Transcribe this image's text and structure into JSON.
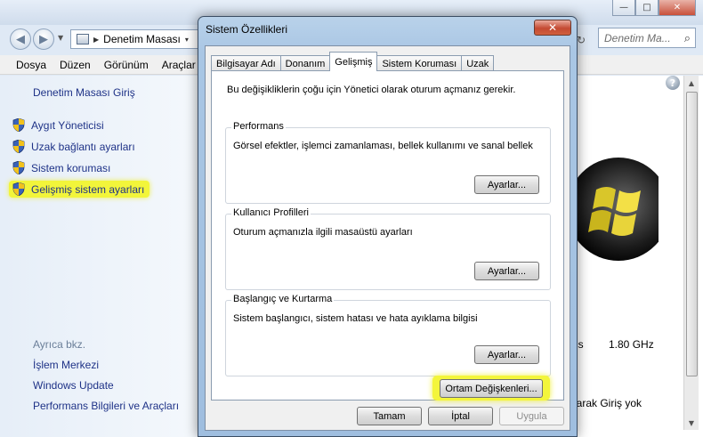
{
  "explorer": {
    "window_controls": {
      "minimize": "—",
      "maximize": "□",
      "close": "✕"
    },
    "address": {
      "path_separator": "▶",
      "path": "Denetim Masası",
      "path_chevron": "▾"
    },
    "search_placeholder": "Denetim Ma...",
    "menu": [
      "Dosya",
      "Düzen",
      "Görünüm",
      "Araçlar"
    ],
    "sidebar": {
      "home_link": "Denetim Masası Giriş",
      "tasks": [
        {
          "label": "Aygıt Yöneticisi",
          "icon": "uac-shield-icon"
        },
        {
          "label": "Uzak bağlantı ayarları",
          "icon": "uac-shield-icon"
        },
        {
          "label": "Sistem koruması",
          "icon": "uac-shield-icon"
        },
        {
          "label": "Gelişmiş sistem ayarları",
          "icon": "uac-shield-icon",
          "highlighted": true
        }
      ],
      "see_also_heading": "Ayrıca bkz.",
      "see_also": [
        "İşlem Merkezi",
        "Windows Update",
        "Performans Bilgileri ve Araçları"
      ]
    },
    "content": {
      "cpu_label_fragment": "ics",
      "cpu_speed": "1.80 GHz",
      "activation_fragment": "harak Giriş yok"
    }
  },
  "dialog": {
    "title": "Sistem Özellikleri",
    "close_label": "✕",
    "tabs": [
      {
        "label": "Bilgisayar Adı",
        "active": false
      },
      {
        "label": "Donanım",
        "active": false
      },
      {
        "label": "Gelişmiş",
        "active": true
      },
      {
        "label": "Sistem Koruması",
        "active": false
      },
      {
        "label": "Uzak",
        "active": false
      }
    ],
    "admin_note": "Bu değişikliklerin çoğu için Yönetici olarak oturum açmanız gerekir.",
    "groups": [
      {
        "title": "Performans",
        "description": "Görsel efektler, işlemci zamanlaması, bellek kullanımı ve sanal bellek",
        "button": "Ayarlar..."
      },
      {
        "title": "Kullanıcı Profilleri",
        "description": "Oturum açmanızla ilgili masaüstü ayarları",
        "button": "Ayarlar..."
      },
      {
        "title": "Başlangıç ve Kurtarma",
        "description": "Sistem başlangıcı, sistem hatası ve hata ayıklama bilgisi",
        "button": "Ayarlar..."
      }
    ],
    "env_button": "Ortam Değişkenleri...",
    "footer": {
      "ok": "Tamam",
      "cancel": "İptal",
      "apply": "Uygula"
    }
  },
  "colors": {
    "highlight": "#f2f53a",
    "link": "#1e3287",
    "dialog_frame": "#a9c6e4"
  }
}
